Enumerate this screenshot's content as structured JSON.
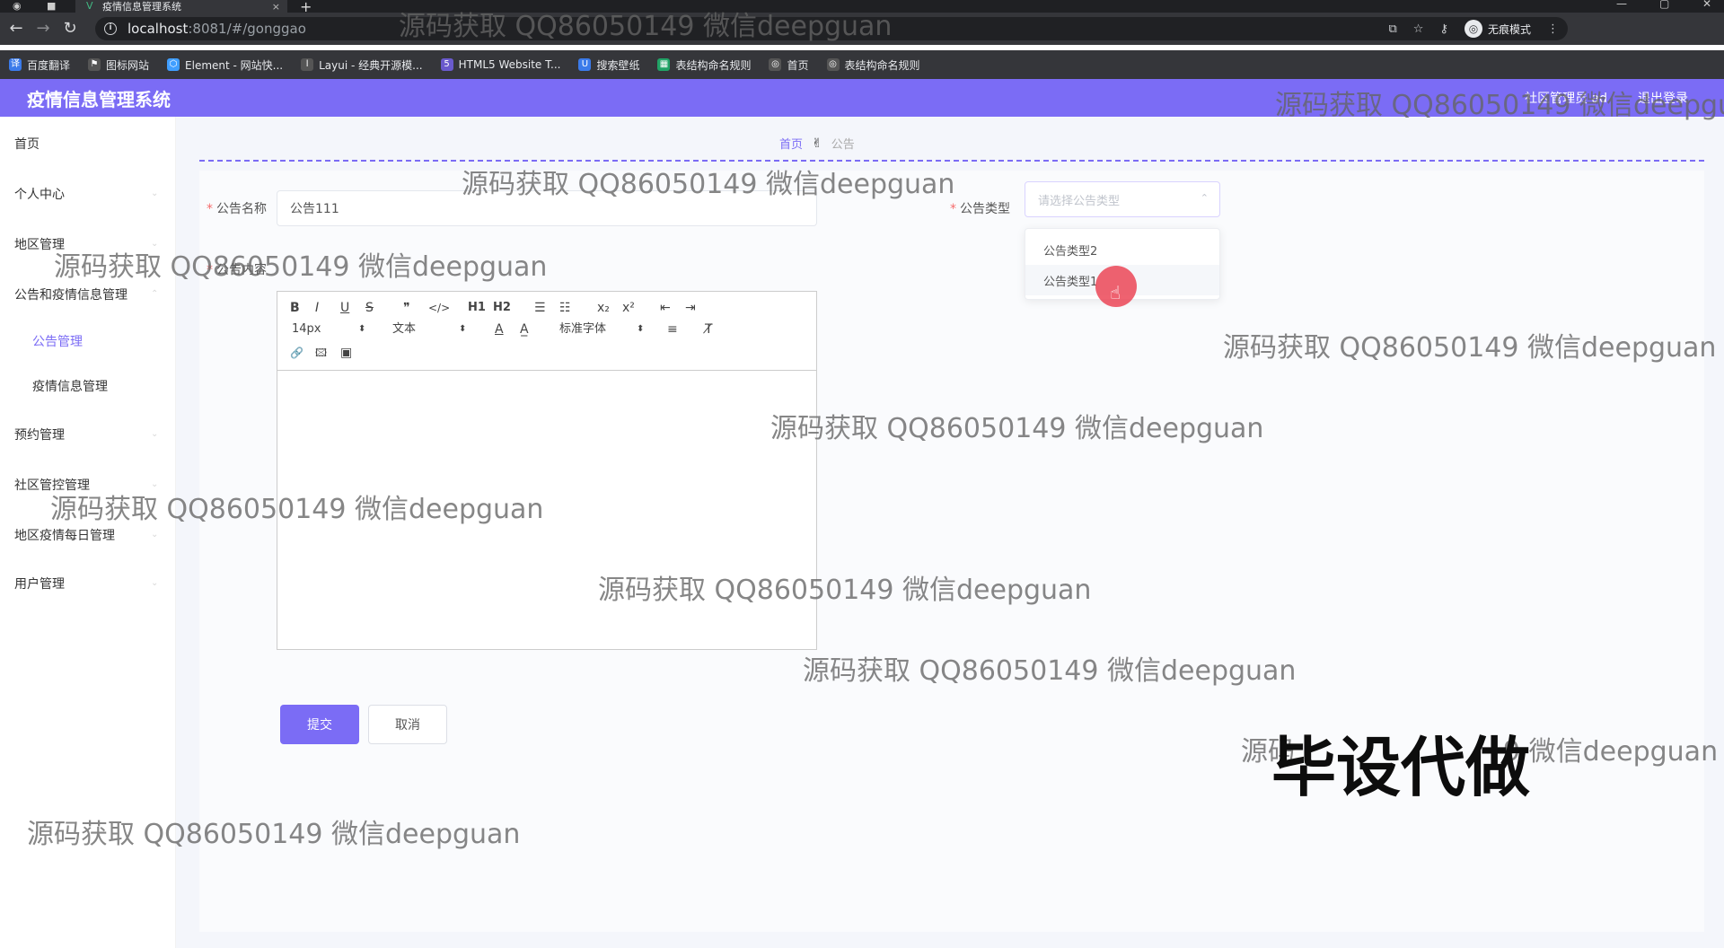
{
  "browser": {
    "tab_title": "疫情信息管理系统",
    "tab_close": "×",
    "new_tab": "+",
    "url_host": "localhost",
    "url_rest": ":8081/#/gonggao",
    "incognito_label": "无痕模式",
    "window_controls": [
      "—",
      "▢",
      "✕"
    ]
  },
  "bookmarks": [
    {
      "label": "百度翻译",
      "icon": "translate-icon",
      "color": "#3b7bea"
    },
    {
      "label": "图标网站",
      "icon": "flag-icon",
      "color": "#555555"
    },
    {
      "label": "Element - 网站快...",
      "icon": "element-icon",
      "color": "#409eff"
    },
    {
      "label": "Layui - 经典开源模...",
      "icon": "layui-icon",
      "color": "#555555"
    },
    {
      "label": "HTML5 Website T...",
      "icon": "html5-icon",
      "color": "#6a5acd"
    },
    {
      "label": "搜索壁纸",
      "icon": "wallpaper-icon",
      "color": "#3b7bea"
    },
    {
      "label": "表结构命名规则",
      "icon": "sheet-icon",
      "color": "#21a366"
    },
    {
      "label": "首页",
      "icon": "globe-icon",
      "color": "#555555"
    },
    {
      "label": "表结构命名规则",
      "icon": "globe-icon",
      "color": "#555555"
    }
  ],
  "header": {
    "title": "疫情信息管理系统",
    "user_role": "社区管理员 ad",
    "logout": "退出登录",
    "accent": "#7b6cf5"
  },
  "sidebar": {
    "items": [
      {
        "label": "首页"
      },
      {
        "label": "个人中心"
      },
      {
        "label": "地区管理"
      },
      {
        "label": "公告和疫情信息管理"
      },
      {
        "label": "公告管理"
      },
      {
        "label": "疫情信息管理"
      },
      {
        "label": "预约管理"
      },
      {
        "label": "社区管控管理"
      },
      {
        "label": "地区疫情每日管理"
      },
      {
        "label": "用户管理"
      }
    ]
  },
  "breadcrumb": {
    "home": "首页",
    "sep_icon": "hand-icon",
    "current": "公告"
  },
  "form": {
    "name_label": "公告名称",
    "name_value": "公告111",
    "type_label": "公告类型",
    "type_placeholder": "请选择公告类型",
    "type_options": [
      "公告类型2",
      "公告类型1"
    ],
    "content_label": "公告内容",
    "required_mark": "*"
  },
  "editor": {
    "font_size": "14px",
    "block_type": "文本",
    "font_family": "标准字体",
    "buttons_row1": [
      "B",
      "I",
      "U",
      "S",
      "❞",
      "</>",
      "H1",
      "H2",
      "☰",
      "☷",
      "x₂",
      "x²",
      "⇤",
      "⇥"
    ],
    "buttons_row2_extra": [
      "A",
      "A̲",
      "≡",
      "T̸"
    ],
    "buttons_row3": [
      "🔗",
      "🖾",
      "▣"
    ]
  },
  "actions": {
    "submit": "提交",
    "cancel": "取消"
  },
  "watermarks": {
    "text": "源码获取 QQ86050149 微信deepguan",
    "partial_right": "源码获取 QQ86050149 微信deepgu",
    "partial_bottom_left": "源码",
    "partial_bottom_right": "9 微信deepguan",
    "stamp": "毕设代做"
  }
}
